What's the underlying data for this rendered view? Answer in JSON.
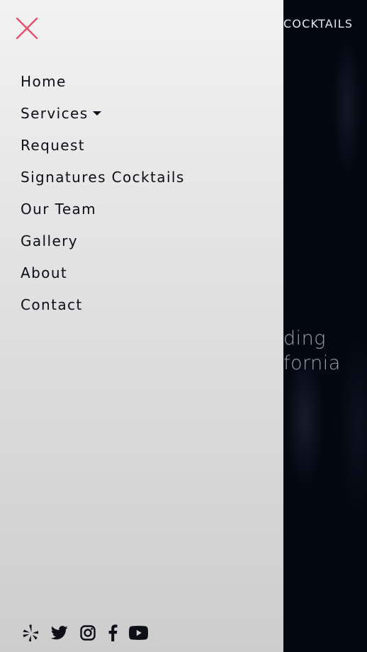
{
  "header": {
    "brand_partial": "COCKTAILS"
  },
  "hero": {
    "line1_partial": "ding",
    "line2_partial": "fornia"
  },
  "drawer": {
    "close_icon": "close-x-icon",
    "menu": [
      {
        "label": "Home"
      },
      {
        "label": "Services",
        "has_dropdown": true
      },
      {
        "label": "Request"
      },
      {
        "label": "Signatures Cocktails"
      },
      {
        "label": "Our Team"
      },
      {
        "label": "Gallery"
      },
      {
        "label": "About"
      },
      {
        "label": "Contact"
      }
    ],
    "social_icons": [
      "yelp-icon",
      "twitter-icon",
      "instagram-icon",
      "facebook-icon",
      "youtube-icon"
    ]
  },
  "colors": {
    "accent_close": "#e8506c",
    "menu_text": "#0c0f16",
    "background_dark": "#020710",
    "drawer_top": "#f2f2f2",
    "drawer_bottom": "#cdcdcd"
  }
}
